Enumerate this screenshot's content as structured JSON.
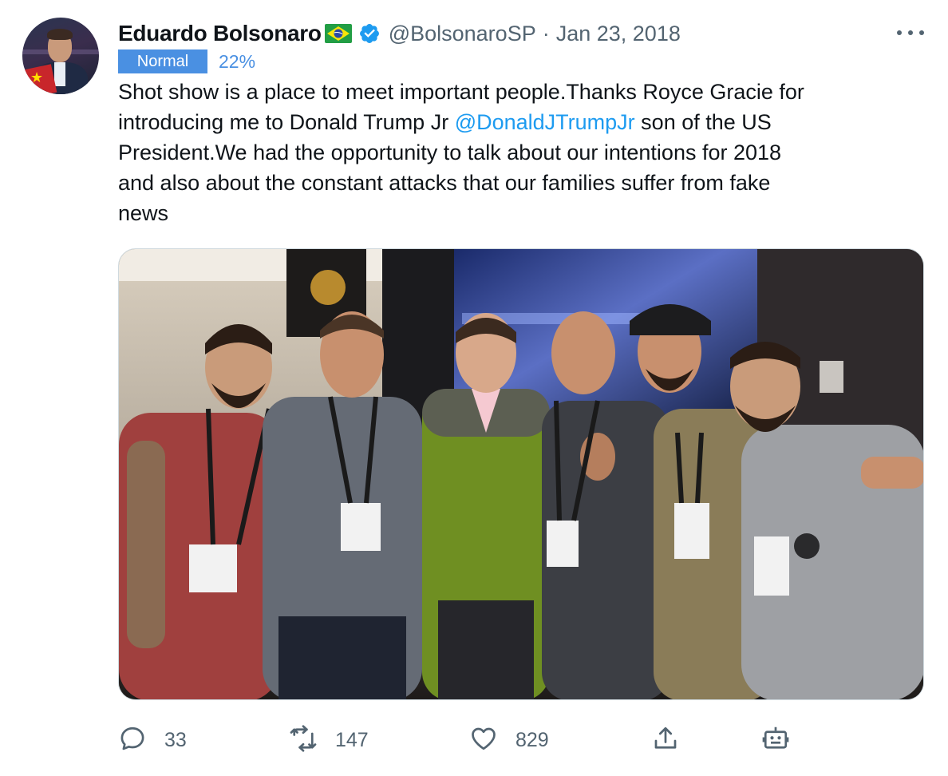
{
  "author": {
    "name": "Eduardo Bolsonaro",
    "handle": "@BolsonaroSP",
    "separator": "·",
    "date": "Jan 23, 2018"
  },
  "rating": {
    "label": "Normal",
    "percent": "22%"
  },
  "tweet": {
    "line1": "Shot show is a place to meet important people.Thanks Royce Gracie for",
    "line2_pre": "introducing me to Donald Trump Jr ",
    "mention": "@DonaldJTrumpJr",
    "line2_post": " son of the US",
    "line3": "President.We had the opportunity to talk about our intentions for 2018",
    "line4": "and also about the constant attacks that our families suffer from fake",
    "line5": "news"
  },
  "actions": {
    "replies": "33",
    "retweets": "147",
    "likes": "829"
  },
  "colors": {
    "accent": "#1d9bf0",
    "badge": "#4a90e2",
    "muted": "#536471",
    "text": "#0f1419"
  },
  "icons": [
    "verified-badge-icon",
    "brazil-flag-icon",
    "more-options-icon",
    "reply-icon",
    "retweet-icon",
    "like-icon",
    "share-icon",
    "bot-icon"
  ]
}
